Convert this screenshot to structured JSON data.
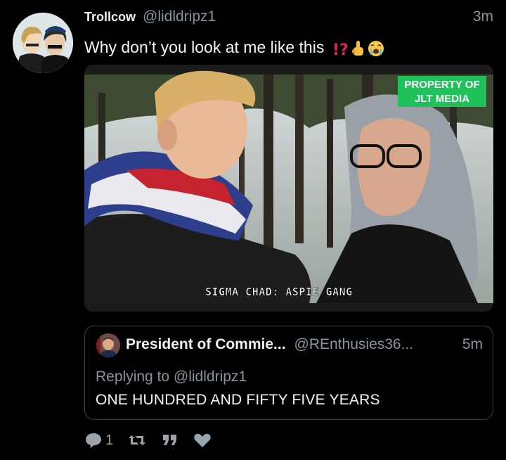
{
  "tweet": {
    "display_name": "Trollcow",
    "handle": "@lidldripz1",
    "time": "3m",
    "text": "Why don’t you look at me like this",
    "emojis": [
      "exclamation-question-icon",
      "pointing-up-icon",
      "crying-face-icon"
    ]
  },
  "media": {
    "watermark_line1": "PROPERTY OF",
    "watermark_line2": "JLT MEDIA",
    "caption": "SIGMA CHAD: ASPIE GANG"
  },
  "quote": {
    "display_name": "President of Commie...",
    "handle": "@REnthusies36...",
    "time": "5m",
    "replying_prefix": "Replying to",
    "replying_handle": "@lidldripz1",
    "text": "ONE HUNDRED AND FIFTY FIVE YEARS"
  },
  "actions": {
    "reply_count": "1",
    "icons": [
      "reply-icon",
      "retweet-icon",
      "quote-icon",
      "like-icon"
    ]
  },
  "colors": {
    "background": "#000000",
    "muted": "#8a949c",
    "watermark": "#1fc25a"
  }
}
